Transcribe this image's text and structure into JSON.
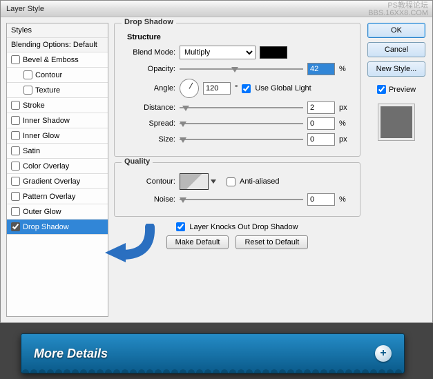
{
  "window": {
    "title": "Layer Style"
  },
  "watermark": {
    "line1": "PS教程论坛",
    "line2": "BBS.16XX8.COM"
  },
  "sidebar": {
    "styles_header": "Styles",
    "blending_header": "Blending Options: Default",
    "items": [
      {
        "label": "Bevel & Emboss",
        "checked": false,
        "indent": false
      },
      {
        "label": "Contour",
        "checked": false,
        "indent": true
      },
      {
        "label": "Texture",
        "checked": false,
        "indent": true
      },
      {
        "label": "Stroke",
        "checked": false,
        "indent": false
      },
      {
        "label": "Inner Shadow",
        "checked": false,
        "indent": false
      },
      {
        "label": "Inner Glow",
        "checked": false,
        "indent": false
      },
      {
        "label": "Satin",
        "checked": false,
        "indent": false
      },
      {
        "label": "Color Overlay",
        "checked": false,
        "indent": false
      },
      {
        "label": "Gradient Overlay",
        "checked": false,
        "indent": false
      },
      {
        "label": "Pattern Overlay",
        "checked": false,
        "indent": false
      },
      {
        "label": "Outer Glow",
        "checked": false,
        "indent": false
      },
      {
        "label": "Drop Shadow",
        "checked": true,
        "indent": false,
        "selected": true
      }
    ]
  },
  "panel": {
    "title": "Drop Shadow",
    "structure": {
      "title": "Structure",
      "blend_mode": {
        "label": "Blend Mode:",
        "value": "Multiply"
      },
      "color": "#000000",
      "opacity": {
        "label": "Opacity:",
        "value": "42",
        "unit": "%"
      },
      "angle": {
        "label": "Angle:",
        "value": "120",
        "unit": "°"
      },
      "use_global": {
        "label": "Use Global Light",
        "checked": true
      },
      "distance": {
        "label": "Distance:",
        "value": "2",
        "unit": "px"
      },
      "spread": {
        "label": "Spread:",
        "value": "0",
        "unit": "%"
      },
      "size": {
        "label": "Size:",
        "value": "0",
        "unit": "px"
      }
    },
    "quality": {
      "title": "Quality",
      "contour_label": "Contour:",
      "anti_aliased": {
        "label": "Anti-aliased",
        "checked": false
      },
      "noise": {
        "label": "Noise:",
        "value": "0",
        "unit": "%"
      }
    },
    "knockout": {
      "label": "Layer Knocks Out Drop Shadow",
      "checked": true
    },
    "buttons": {
      "make_default": "Make Default",
      "reset": "Reset to Default"
    }
  },
  "right": {
    "ok": "OK",
    "cancel": "Cancel",
    "new_style": "New Style...",
    "preview_label": "Preview",
    "preview_checked": true
  },
  "footer": {
    "title": "More Details",
    "plus": "+"
  }
}
